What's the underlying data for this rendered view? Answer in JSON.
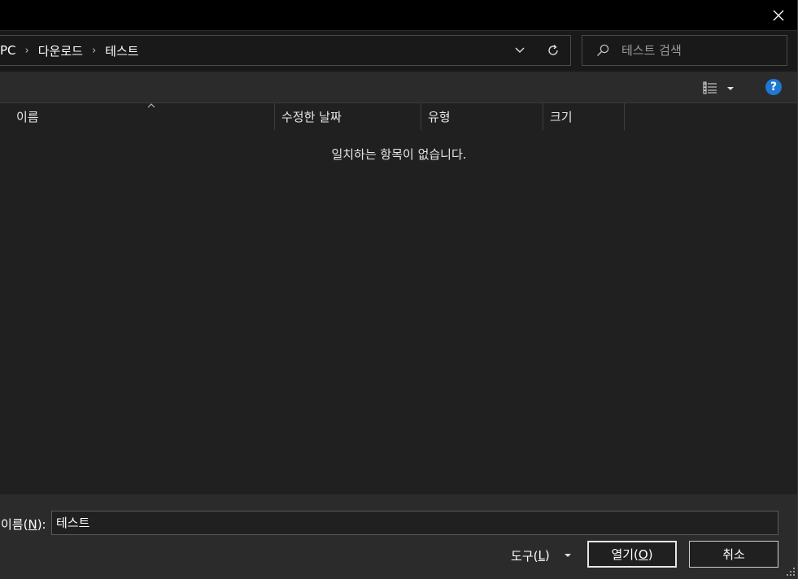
{
  "window": {
    "close_icon": "close-icon"
  },
  "address_bar": {
    "crumbs": [
      "PC",
      "다운로드",
      "테스트"
    ],
    "separator": "›"
  },
  "search": {
    "placeholder": "테스트 검색"
  },
  "toolbar": {
    "view_icon": "details-view-icon",
    "help_label": "?"
  },
  "file_list": {
    "columns": [
      "이름",
      "수정한 날짜",
      "유형",
      "크기"
    ],
    "sort_indicator": "^",
    "empty_message": "일치하는 항목이 없습니다."
  },
  "footer": {
    "name_label_pre": "이름(",
    "name_label_key": "N",
    "name_label_post": "):",
    "name_value": "테스트",
    "tools_label_pre": "도구(",
    "tools_label_key": "L",
    "tools_label_post": ")",
    "open_label_pre": "열기(",
    "open_label_key": "O",
    "open_label_post": ")",
    "cancel_label": "취소"
  },
  "colors": {
    "titlebar": "#000000",
    "background": "#202020",
    "toolbar": "#2b2b2b",
    "help_accent": "#1e78d2"
  }
}
